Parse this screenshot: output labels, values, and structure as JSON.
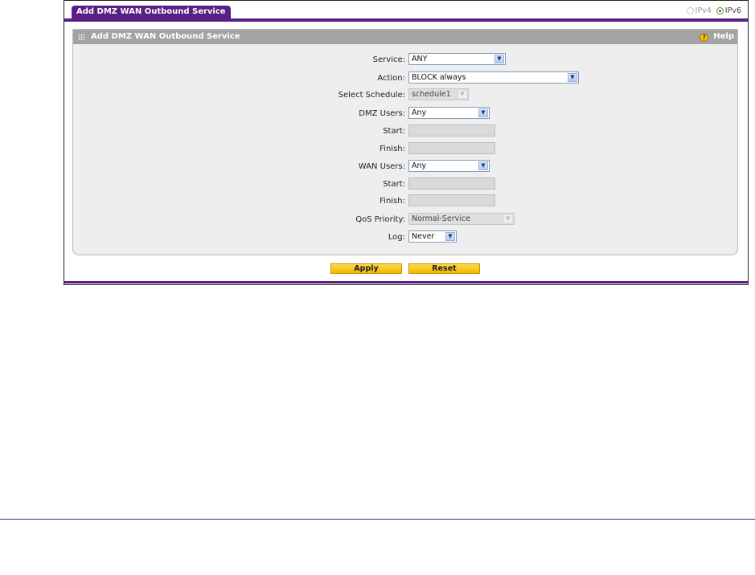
{
  "tab": {
    "title": "Add DMZ WAN Outbound Service"
  },
  "ip_selector": {
    "ipv4_label": "IPv4",
    "ipv6_label": "IPv6",
    "selected": "IPv6"
  },
  "panel": {
    "title": "Add DMZ WAN Outbound Service",
    "help_label": "Help"
  },
  "form": {
    "service": {
      "label": "Service:",
      "value": "ANY"
    },
    "action": {
      "label": "Action:",
      "value": "BLOCK always"
    },
    "schedule": {
      "label": "Select Schedule:",
      "value": "schedule1"
    },
    "dmz_users": {
      "label": "DMZ Users:",
      "value": "Any"
    },
    "dmz_start": {
      "label": "Start:",
      "value": ""
    },
    "dmz_finish": {
      "label": "Finish:",
      "value": ""
    },
    "wan_users": {
      "label": "WAN Users:",
      "value": "Any"
    },
    "wan_start": {
      "label": "Start:",
      "value": ""
    },
    "wan_finish": {
      "label": "Finish:",
      "value": ""
    },
    "qos": {
      "label": "QoS Priority:",
      "value": "Normal-Service"
    },
    "log": {
      "label": "Log:",
      "value": "Never"
    }
  },
  "buttons": {
    "apply": "Apply",
    "reset": "Reset"
  },
  "colors": {
    "accent": "#5a1e86",
    "button": "#f4b800",
    "panel_header": "#a3a3a3"
  },
  "icons": {
    "help": "help-icon",
    "dropdown": "chevron-down-icon",
    "grip": "grip-icon"
  }
}
